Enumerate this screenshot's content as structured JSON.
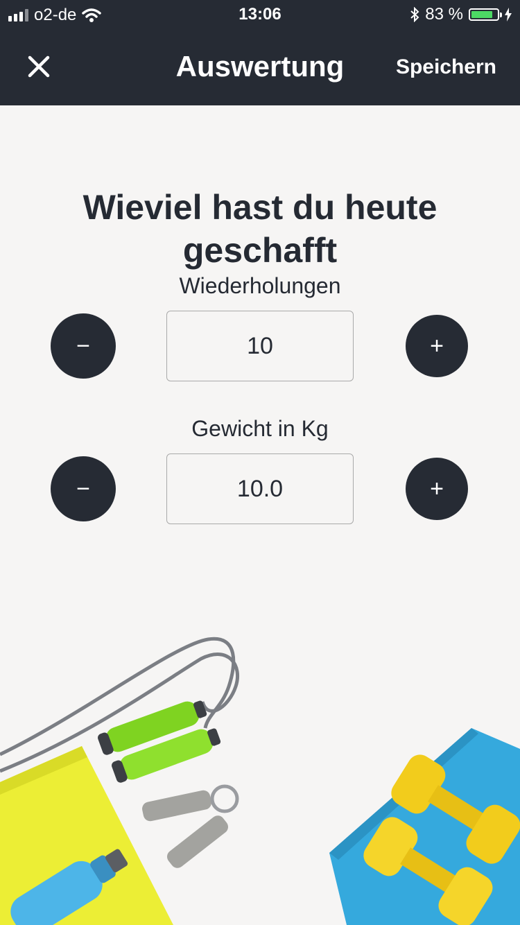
{
  "status_bar": {
    "carrier": "o2-de",
    "time": "13:06",
    "battery_percent": "83 %",
    "battery_level": 0.83,
    "icons": [
      "signal-icon",
      "wifi-icon",
      "bluetooth-icon",
      "battery-icon",
      "charging-icon"
    ]
  },
  "navbar": {
    "title": "Auswertung",
    "save_label": "Speichern",
    "close_icon": "close-icon"
  },
  "content": {
    "headline": "Wieviel hast du heute geschafft",
    "repetitions": {
      "label": "Wiederholungen",
      "value": "10",
      "minus_label": "−",
      "plus_label": "+"
    },
    "weight": {
      "label": "Gewicht in Kg",
      "value": "10.0",
      "minus_label": "−",
      "plus_label": "+"
    }
  },
  "illustration": {
    "items": [
      "jump-rope",
      "hand-grip",
      "water-bottle",
      "yellow-towel",
      "blue-towel",
      "dumbbells"
    ],
    "colors": {
      "rope_handle": "#7fd321",
      "yellow_towel": "#ecee35",
      "blue_towel": "#35a9dd",
      "dumbbell": "#f2cc1c",
      "bottle": "#4db5e8",
      "rope": "#7b7e84"
    }
  }
}
